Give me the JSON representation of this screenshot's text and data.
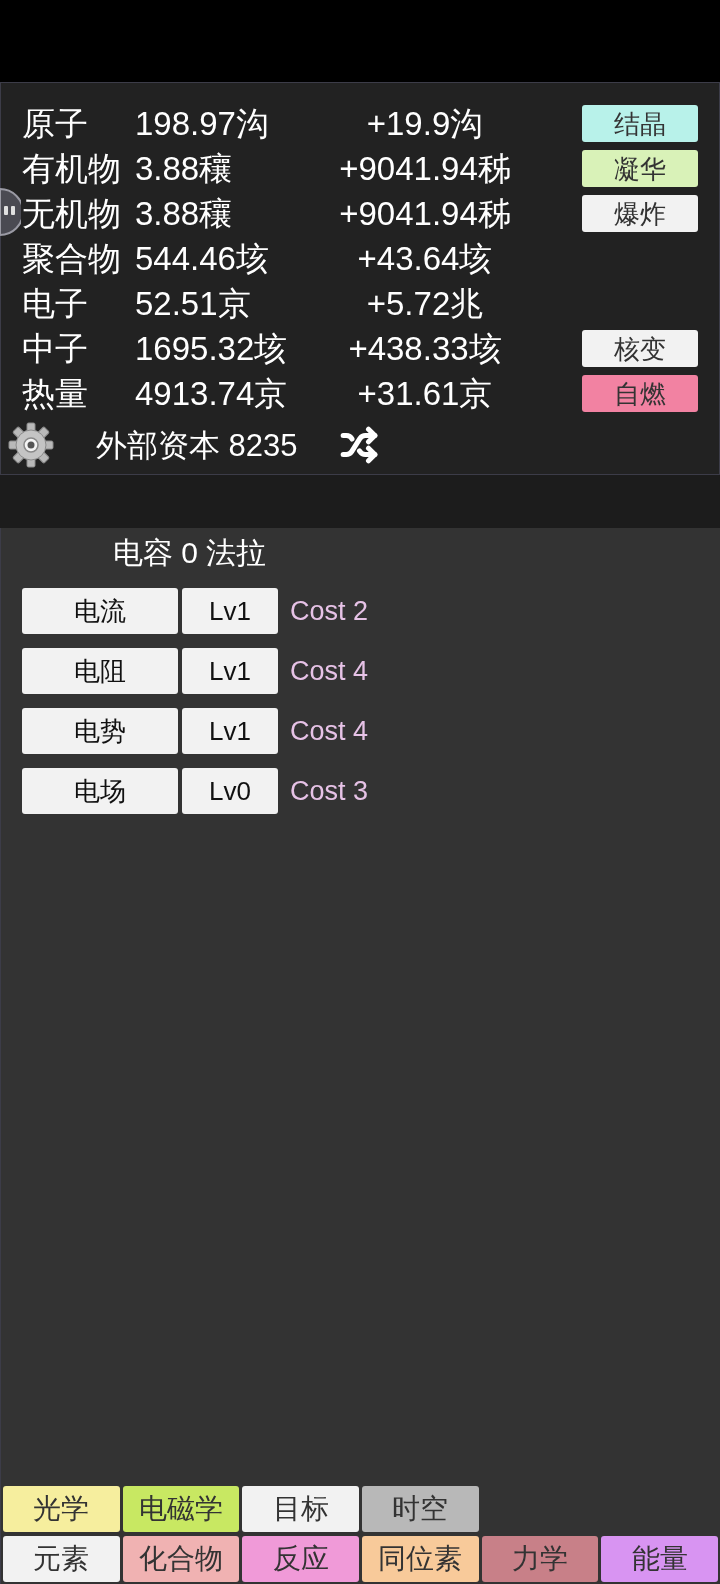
{
  "resources": [
    {
      "name": "原子",
      "amount": "198.97沟",
      "rate": "+19.9沟",
      "action": {
        "label": "结晶",
        "color": "#b8f2ea"
      }
    },
    {
      "name": "有机物",
      "amount": "3.88穰",
      "rate": "+9041.94秭",
      "action": {
        "label": "凝华",
        "color": "#d9f2b8"
      }
    },
    {
      "name": "无机物",
      "amount": "3.88穰",
      "rate": "+9041.94秭",
      "action": {
        "label": "爆炸",
        "color": "#f2f2f2"
      }
    },
    {
      "name": "聚合物",
      "amount": "544.46垓",
      "rate": "+43.64垓"
    },
    {
      "name": "电子",
      "amount": "52.51京",
      "rate": "+5.72兆"
    },
    {
      "name": "中子",
      "amount": "1695.32垓",
      "rate": "+438.33垓",
      "action": {
        "label": "核变",
        "color": "#f2f2f2"
      }
    },
    {
      "name": "热量",
      "amount": "4913.74京",
      "rate": "+31.61京",
      "action": {
        "label": "自燃",
        "color": "#f282a2"
      }
    }
  ],
  "capital": {
    "label": "外部资本 8235"
  },
  "capacitance": {
    "title": "电容 0 法拉"
  },
  "upgrades": [
    {
      "name": "电流",
      "level": "Lv1",
      "cost": "Cost 2"
    },
    {
      "name": "电阻",
      "level": "Lv1",
      "cost": "Cost 4"
    },
    {
      "name": "电势",
      "level": "Lv1",
      "cost": "Cost 4"
    },
    {
      "name": "电场",
      "level": "Lv0",
      "cost": "Cost 3"
    }
  ],
  "tab_rows": [
    {
      "tabs": [
        {
          "label": "光学",
          "color": "#f6ee9e"
        },
        {
          "label": "电磁学",
          "color": "#c8e862"
        },
        {
          "label": "目标",
          "color": "#f2f2f2"
        },
        {
          "label": "时空",
          "color": "#b8b8b8"
        }
      ]
    },
    {
      "tabs": [
        {
          "label": "元素",
          "color": "#f2f2f2"
        },
        {
          "label": "化合物",
          "color": "#f0b2b2"
        },
        {
          "label": "反应",
          "color": "#f09ad8"
        },
        {
          "label": "同位素",
          "color": "#f8ca9a"
        },
        {
          "label": "力学",
          "color": "#c88088"
        },
        {
          "label": "能量",
          "color": "#d894f2"
        }
      ]
    }
  ]
}
